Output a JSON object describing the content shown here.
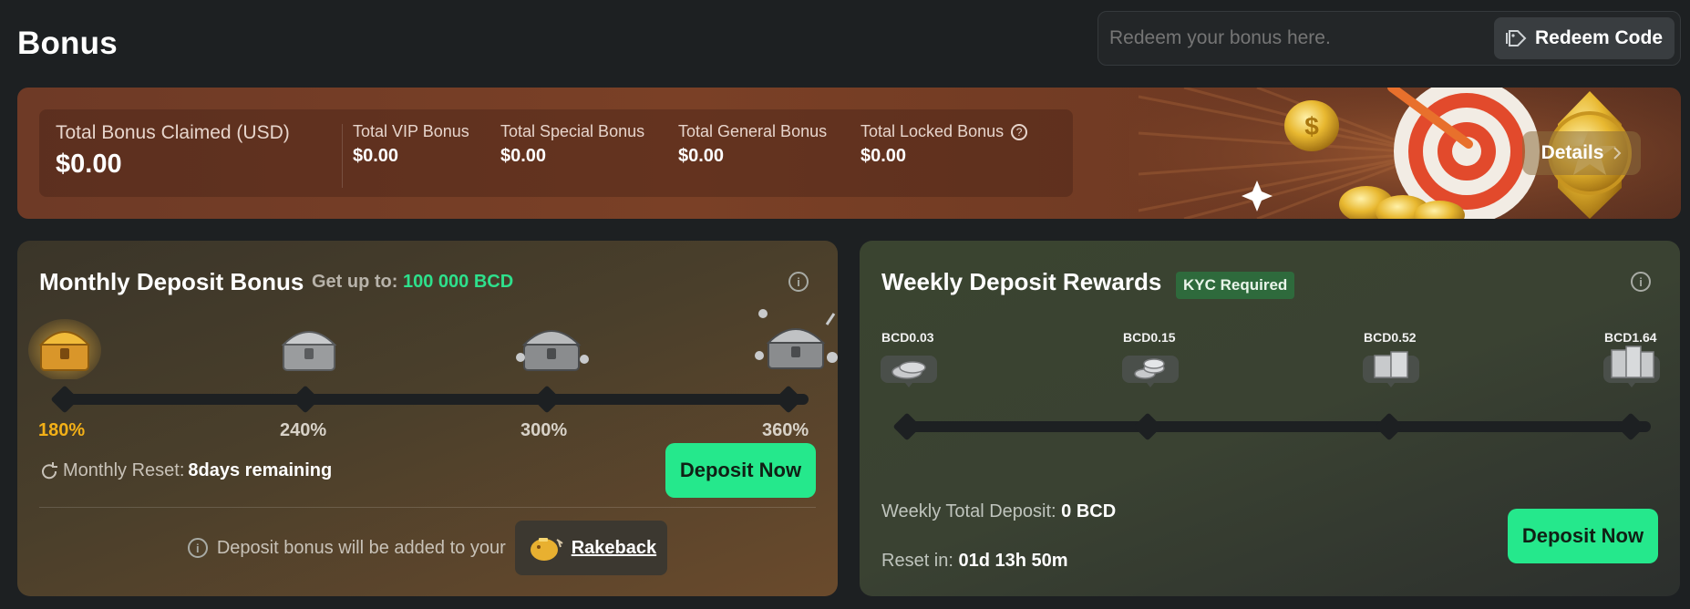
{
  "page": {
    "title": "Bonus"
  },
  "redeem": {
    "placeholder": "Redeem your bonus here.",
    "button_label": "Redeem Code",
    "button_icon": "tag-icon"
  },
  "summary": {
    "total_claimed_label": "Total Bonus Claimed (USD)",
    "total_claimed_value": "$0.00",
    "stats": [
      {
        "label": "Total VIP Bonus",
        "value": "$0.00"
      },
      {
        "label": "Total Special Bonus",
        "value": "$0.00"
      },
      {
        "label": "Total General Bonus",
        "value": "$0.00"
      },
      {
        "label": "Total Locked Bonus",
        "value": "$0.00",
        "has_help_icon": true
      }
    ],
    "details_label": "Details",
    "details_icon": "chevron-right-icon"
  },
  "monthly": {
    "title": "Monthly Deposit Bonus",
    "getup_prefix": "Get up to:",
    "getup_value": "100 000 BCD",
    "tiers": [
      {
        "percent": "180%",
        "active": true,
        "chest": "gold-chest-icon"
      },
      {
        "percent": "240%",
        "active": false,
        "chest": "silver-chest-icon"
      },
      {
        "percent": "300%",
        "active": false,
        "chest": "silver-chest-open-icon"
      },
      {
        "percent": "360%",
        "active": false,
        "chest": "silver-chest-burst-icon"
      }
    ],
    "reset_label": "Monthly Reset:",
    "reset_value": "8days remaining",
    "deposit_label": "Deposit Now",
    "note_text": "Deposit bonus will be added to your",
    "rakeback_label": "Rakeback",
    "accent_color": "#2ee08c",
    "active_color": "#f3b017"
  },
  "weekly": {
    "title": "Weekly Deposit Rewards",
    "kyc_label": "KYC Required",
    "rewards": [
      "BCD0.03",
      "BCD0.15",
      "BCD0.52",
      "BCD1.64"
    ],
    "total_label": "Weekly Total Deposit:",
    "total_value": "0 BCD",
    "reset_label": "Reset in:",
    "reset_value": "01d 13h 50m",
    "deposit_label": "Deposit Now"
  },
  "colors": {
    "background": "#1d2022",
    "button_green": "#25e88c",
    "kyc_green": "#2e6a3c"
  }
}
